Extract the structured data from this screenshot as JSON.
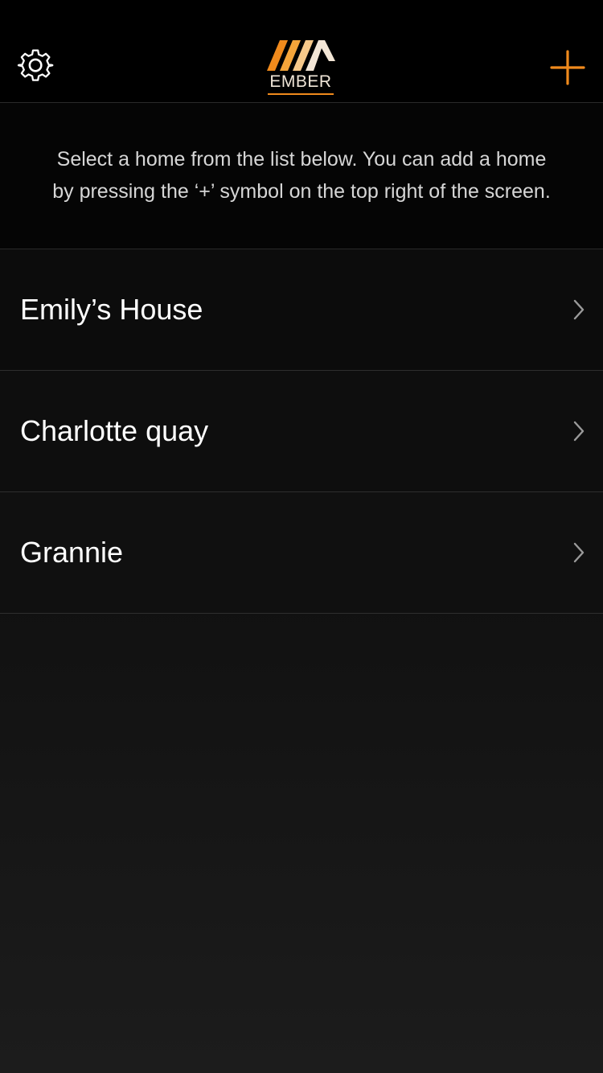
{
  "app": {
    "logo_text": "EMBER"
  },
  "colors": {
    "accent": "#F08A1C",
    "background": "#000000",
    "text": "#FFFFFF",
    "muted_text": "#D6D6D6",
    "chevron": "#9A9A9A"
  },
  "header": {
    "left_icon": "gear-icon",
    "right_icon": "plus-icon"
  },
  "intro": {
    "text": "Select a home from the list below.  You can add a home\nby pressing the ‘+’ symbol on the top right of the screen."
  },
  "homes": [
    {
      "name": "Emily’s House",
      "icon": "chevron-right-icon"
    },
    {
      "name": "Charlotte quay",
      "icon": "chevron-right-icon"
    },
    {
      "name": "Grannie",
      "icon": "chevron-right-icon"
    }
  ]
}
